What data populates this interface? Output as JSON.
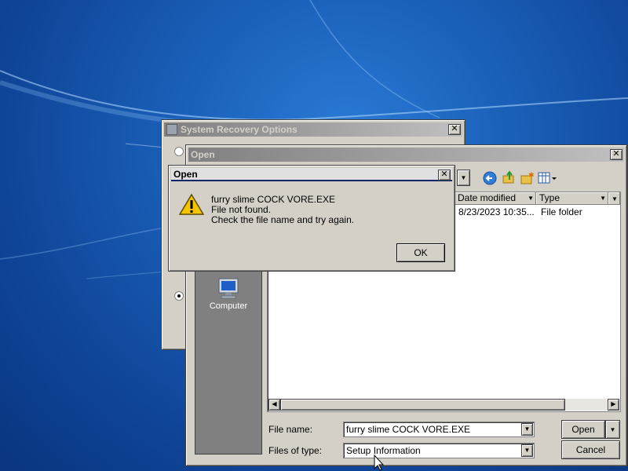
{
  "system_recovery": {
    "title": "System Recovery Options",
    "close": "✕"
  },
  "open_dialog": {
    "title": "Open",
    "close": "✕",
    "columns": {
      "date_modified": "Date modified",
      "type": "Type"
    },
    "row": {
      "date_modified": "8/23/2023 10:35...",
      "type": "File folder"
    },
    "places": {
      "computer": "Computer"
    },
    "file_name_label": "File name:",
    "file_name_value": "furry slime COCK VORE.EXE",
    "files_of_type_label": "Files of type:",
    "files_of_type_value": "Setup Information",
    "open_button": "Open",
    "cancel_button": "Cancel"
  },
  "message_box": {
    "title": "Open",
    "close": "✕",
    "lines": [
      "furry slime COCK VORE.EXE",
      "File not found.",
      "Check the file name and try again."
    ],
    "ok_button": "OK"
  },
  "icons": {
    "warning": "warning-icon",
    "computer": "computer-icon",
    "back": "back-icon",
    "up_folder": "up-folder-icon",
    "new_folder": "new-folder-icon",
    "views": "views-menu-icon"
  }
}
